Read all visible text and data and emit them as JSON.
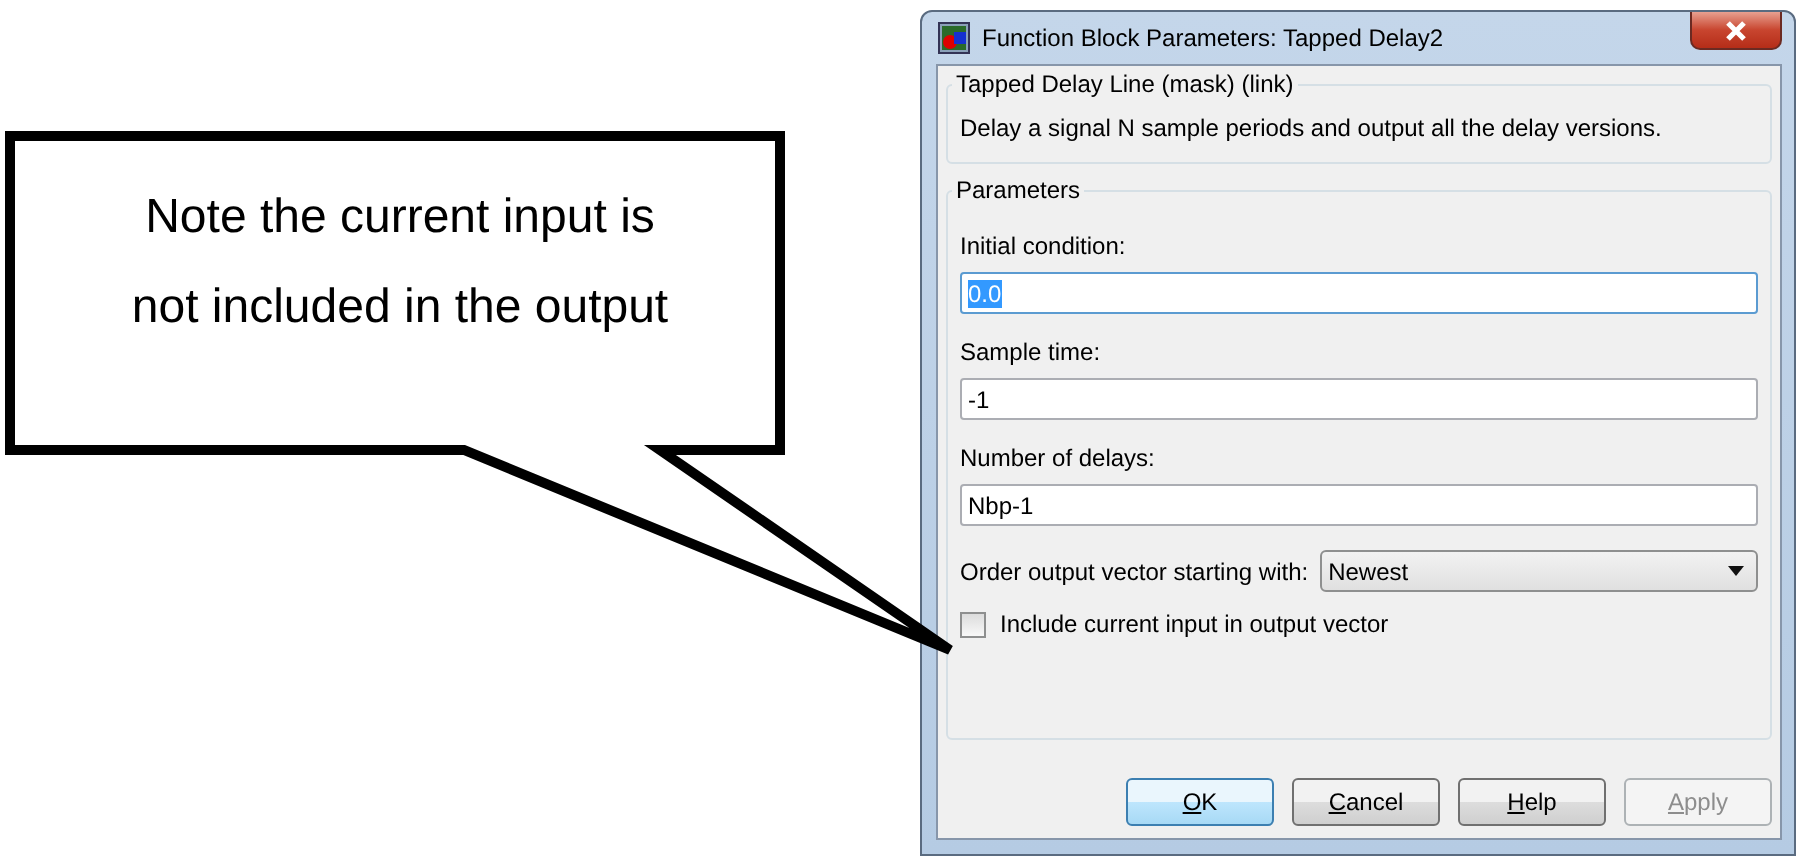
{
  "callout": {
    "text": "Note the current input is not included in the output"
  },
  "title_bar": {
    "title": "Function Block Parameters: Tapped Delay2"
  },
  "description_group": {
    "title": "Tapped Delay Line (mask) (link)",
    "text": "Delay a signal N sample periods and output all the delay versions."
  },
  "parameters_group": {
    "title": "Parameters",
    "fields": [
      {
        "label": "Initial condition:",
        "value": "0.0",
        "text_selected": true
      },
      {
        "label": "Sample time:",
        "value": "-1",
        "text_selected": false
      },
      {
        "label": "Number of delays:",
        "value": "Nbp-1",
        "text_selected": false
      }
    ],
    "dropdown": {
      "label": "Order output vector starting with:",
      "value": "Newest"
    },
    "checkbox": {
      "label": "Include current input in output vector",
      "checked": false
    }
  },
  "buttons": [
    {
      "label": "OK",
      "default": true,
      "disabled": false
    },
    {
      "label": "Cancel",
      "default": false,
      "disabled": false
    },
    {
      "label": "Help",
      "default": false,
      "disabled": false
    },
    {
      "label": "Apply",
      "default": false,
      "disabled": true
    }
  ]
}
